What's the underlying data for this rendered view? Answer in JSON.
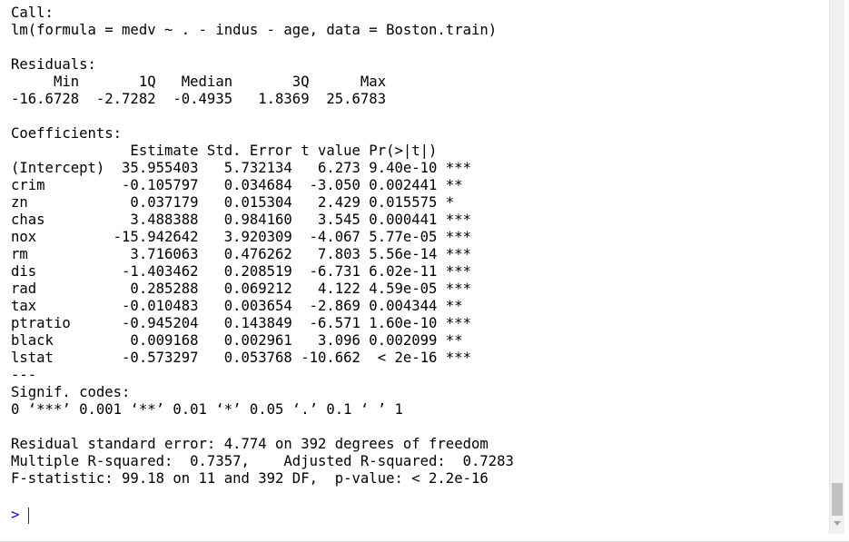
{
  "console": {
    "lines": [
      "Call:",
      "lm(formula = medv ~ . - indus - age, data = Boston.train)",
      "",
      "Residuals:",
      "     Min       1Q   Median       3Q      Max ",
      "-16.6728  -2.7282  -0.4935   1.8369  25.6783 ",
      "",
      "Coefficients:",
      "              Estimate Std. Error t value Pr(>|t|)    ",
      "(Intercept)  35.955403   5.732134   6.273 9.40e-10 ***",
      "crim         -0.105797   0.034684  -3.050 0.002441 ** ",
      "zn            0.037179   0.015304   2.429 0.015575 *  ",
      "chas          3.488388   0.984160   3.545 0.000441 ***",
      "nox         -15.942642   3.920309  -4.067 5.77e-05 ***",
      "rm            3.716063   0.476262   7.803 5.56e-14 ***",
      "dis          -1.403462   0.208519  -6.731 6.02e-11 ***",
      "rad           0.285288   0.069212   4.122 4.59e-05 ***",
      "tax          -0.010483   0.003654  -2.869 0.004344 ** ",
      "ptratio      -0.945204   0.143849  -6.571 1.60e-10 ***",
      "black         0.009168   0.002961   3.096 0.002099 ** ",
      "lstat        -0.573297   0.053768 -10.662  < 2e-16 ***",
      "---",
      "Signif. codes:  ",
      "0 ‘***’ 0.001 ‘**’ 0.01 ‘*’ 0.05 ‘.’ 0.1 ‘ ’ 1",
      "",
      "Residual standard error: 4.774 on 392 degrees of freedom",
      "Multiple R-squared:  0.7357,\tAdjusted R-squared:  0.7283 ",
      "F-statistic: 99.18 on 11 and 392 DF,  p-value: < 2.2e-16"
    ],
    "prompt": ">"
  },
  "colors": {
    "output_text": "#000000",
    "prompt": "#0000ff",
    "scrollbar_track": "#f1f1f1",
    "scrollbar_thumb": "#c1c1c1"
  }
}
